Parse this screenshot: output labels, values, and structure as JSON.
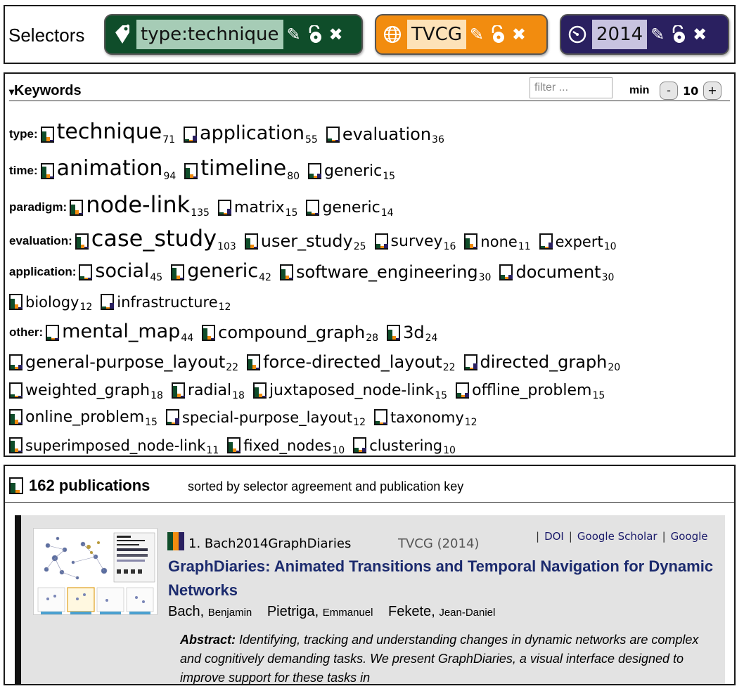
{
  "selectors": {
    "title": "Selectors",
    "chips": [
      {
        "id": "type",
        "label": "type:technique",
        "icon": "tag-icon"
      },
      {
        "id": "venue",
        "label": "TVCG",
        "icon": "globe-icon"
      },
      {
        "id": "year",
        "label": "2014",
        "icon": "clock-icon"
      }
    ],
    "actions": {
      "edit": "✎",
      "lock": "lock-icon",
      "remove": "✖"
    }
  },
  "keywords": {
    "title": "Keywords",
    "toggle": "▾",
    "filter_placeholder": "filter ...",
    "min_label": "min",
    "min_value": "10",
    "minus": "-",
    "plus": "+",
    "categories": [
      {
        "name": "type:",
        "items": [
          [
            "technique",
            "71"
          ],
          [
            "application",
            "55"
          ],
          [
            "evaluation",
            "36"
          ]
        ]
      },
      {
        "name": "time:",
        "items": [
          [
            "animation",
            "94"
          ],
          [
            "timeline",
            "80"
          ],
          [
            "generic",
            "15"
          ]
        ]
      },
      {
        "name": "paradigm:",
        "items": [
          [
            "node-link",
            "135"
          ],
          [
            "matrix",
            "15"
          ],
          [
            "generic",
            "14"
          ]
        ]
      },
      {
        "name": "evaluation:",
        "items": [
          [
            "case_study",
            "103"
          ],
          [
            "user_study",
            "25"
          ],
          [
            "survey",
            "16"
          ],
          [
            "none",
            "11"
          ],
          [
            "expert",
            "10"
          ]
        ]
      },
      {
        "name": "application:",
        "items": [
          [
            "social",
            "45"
          ],
          [
            "generic",
            "42"
          ],
          [
            "software_engineering",
            "30"
          ],
          [
            "document",
            "30"
          ],
          [
            "biology",
            "12"
          ],
          [
            "infrastructure",
            "12"
          ]
        ]
      },
      {
        "name": "other:",
        "items": [
          [
            "mental_map",
            "44"
          ],
          [
            "compound_graph",
            "28"
          ],
          [
            "3d",
            "24"
          ],
          [
            "general-purpose_layout",
            "22"
          ],
          [
            "force-directed_layout",
            "22"
          ],
          [
            "directed_graph",
            "20"
          ],
          [
            "weighted_graph",
            "18"
          ],
          [
            "radial",
            "18"
          ],
          [
            "juxtaposed_node-link",
            "15"
          ],
          [
            "offline_problem",
            "15"
          ],
          [
            "online_problem",
            "15"
          ],
          [
            "special-purpose_layout",
            "12"
          ],
          [
            "taxonomy",
            "12"
          ],
          [
            "superimposed_node-link",
            "11"
          ],
          [
            "fixed_nodes",
            "10"
          ],
          [
            "clustering",
            "10"
          ]
        ]
      }
    ]
  },
  "publications": {
    "count_label": "162 publications",
    "sort_label": "sorted by selector agreement and publication key",
    "items": [
      {
        "key": "1. Bach2014GraphDiaries",
        "venue": "TVCG",
        "year": "(2014)",
        "links": [
          "DOI",
          "Google Scholar",
          "Google"
        ],
        "title": "GraphDiaries: Animated Transitions and Temporal Navigation for Dynamic Networks",
        "authors": [
          {
            "last": "Bach",
            "first": "Benjamin"
          },
          {
            "last": "Pietriga",
            "first": "Emmanuel"
          },
          {
            "last": "Fekete",
            "first": "Jean-Daniel"
          }
        ],
        "abstract_label": "Abstract:",
        "abstract": "Identifying, tracking and understanding changes in dynamic networks are complex and cognitively demanding tasks. We present GraphDiaries, a visual interface designed to improve support for these tasks in"
      }
    ]
  },
  "colors": {
    "green": "#0f4d2a",
    "orange": "#f28c0f",
    "navy": "#2a2060",
    "title_blue": "#1c2b6e"
  }
}
